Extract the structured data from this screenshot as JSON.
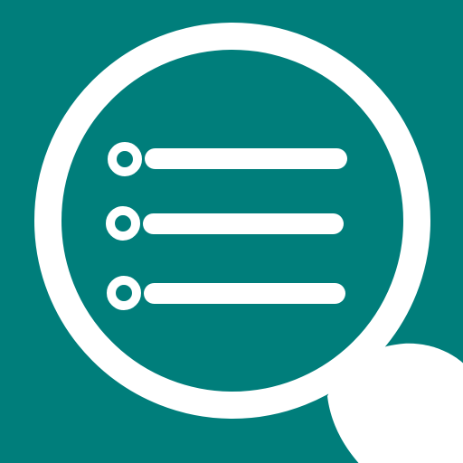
{
  "icon": {
    "name": "search-list-icon",
    "description_visible": false,
    "colors": {
      "background": "#007E7B",
      "foreground": "#FFFFFF"
    },
    "list": {
      "item_count": 3
    }
  }
}
